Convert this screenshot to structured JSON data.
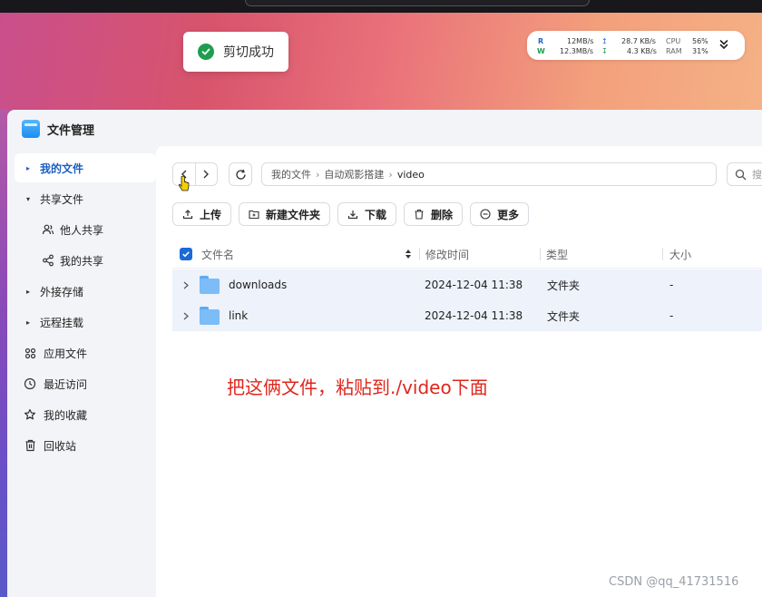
{
  "toast": {
    "text": "剪切成功"
  },
  "stats": {
    "read_label": "R",
    "read_speed": "12MB/s",
    "read_net": "28.7 KB/s",
    "write_label": "W",
    "write_speed": "12.3MB/s",
    "write_net": "4.3 KB/s",
    "cpu_label": "CPU",
    "cpu_value": "56%",
    "ram_label": "RAM",
    "ram_value": "31%"
  },
  "window": {
    "title": "文件管理"
  },
  "sidebar": {
    "items": [
      {
        "label": "我的文件"
      },
      {
        "label": "共享文件"
      },
      {
        "label": "他人共享"
      },
      {
        "label": "我的共享"
      },
      {
        "label": "外接存储"
      },
      {
        "label": "远程挂载"
      },
      {
        "label": "应用文件"
      },
      {
        "label": "最近访问"
      },
      {
        "label": "我的收藏"
      },
      {
        "label": "回收站"
      }
    ]
  },
  "breadcrumb": {
    "parts": [
      "我的文件",
      "自动观影搭建",
      "video"
    ]
  },
  "search": {
    "placeholder": "搜"
  },
  "toolbar": {
    "upload": "上传",
    "new_folder": "新建文件夹",
    "download": "下载",
    "delete": "删除",
    "more": "更多"
  },
  "table": {
    "columns": [
      "文件名",
      "修改时间",
      "类型",
      "大小"
    ],
    "rows": [
      {
        "name": "downloads",
        "modified": "2024-12-04 11:38",
        "type": "文件夹",
        "size": "-"
      },
      {
        "name": "link",
        "modified": "2024-12-04 11:38",
        "type": "文件夹",
        "size": "-"
      }
    ]
  },
  "annotation": "把这俩文件，粘贴到./video下面",
  "watermark": "CSDN @qq_41731516",
  "colors": {
    "accent": "#1b5fc2",
    "success": "#1f9d4f",
    "annotation": "#e0261c",
    "row_highlight": "#edf2fb"
  }
}
